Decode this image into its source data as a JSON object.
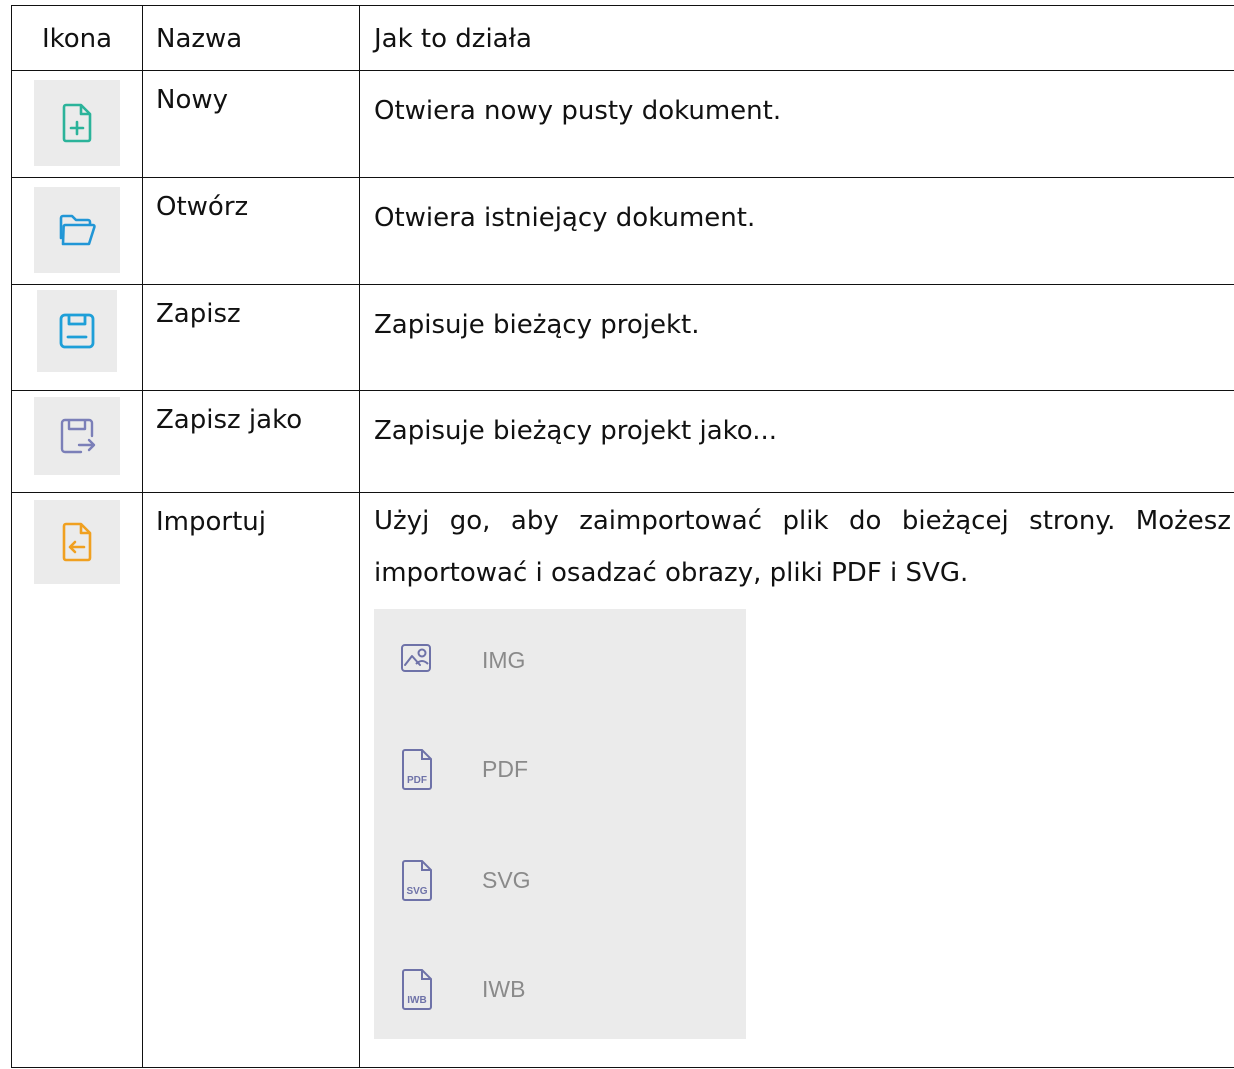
{
  "table": {
    "headers": {
      "icon": "Ikona",
      "name": "Nazwa",
      "description": "Jak to działa"
    },
    "rows": [
      {
        "icon": "new-file-icon",
        "icon_color": "#2bb39a",
        "name": "Nowy",
        "description": "Otwiera nowy pusty dokument."
      },
      {
        "icon": "folder-open-icon",
        "icon_color": "#2196d6",
        "name": "Otwórz",
        "description": "Otwiera istniejący dokument."
      },
      {
        "icon": "save-icon",
        "icon_color": "#1e9fd8",
        "name": "Zapisz",
        "description": "Zapisuje bieżący projekt."
      },
      {
        "icon": "save-as-icon",
        "icon_color": "#7b7fb8",
        "name": "Zapisz jako",
        "description": "Zapisuje bieżący projekt jako..."
      },
      {
        "icon": "import-icon",
        "icon_color": "#f0a020",
        "name": "Importuj",
        "description": "Użyj go, aby zaimportować plik do bieżącej strony. Możesz importować i osadzać obrazy, pliki PDF i SVG.",
        "submenu": [
          {
            "icon": "image-file-icon",
            "label": "IMG"
          },
          {
            "icon": "pdf-file-icon",
            "label": "PDF",
            "badge": "PDF"
          },
          {
            "icon": "svg-file-icon",
            "label": "SVG",
            "badge": "SVG"
          },
          {
            "icon": "iwb-file-icon",
            "label": "IWB",
            "badge": "IWB"
          }
        ]
      }
    ]
  }
}
